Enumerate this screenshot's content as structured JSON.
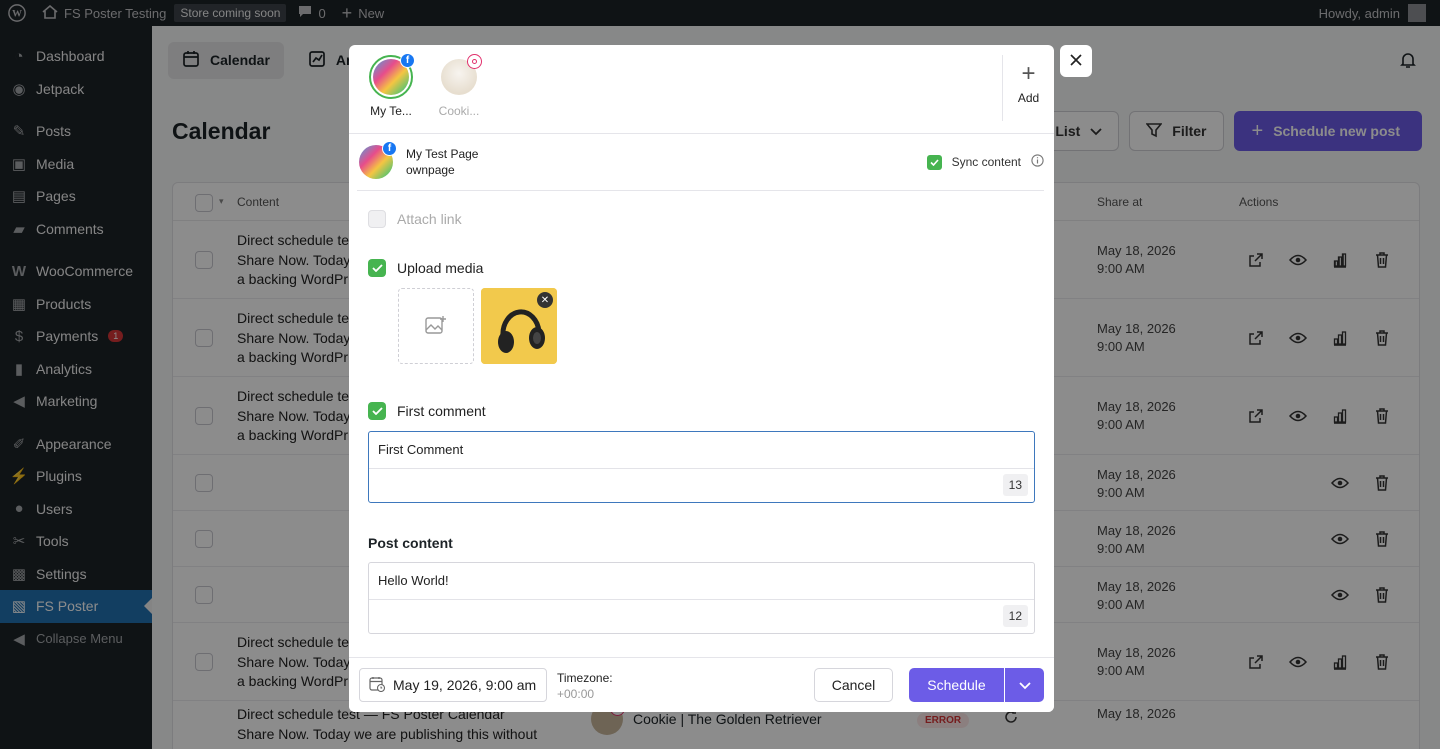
{
  "adminbar": {
    "site_name": "FS Poster Testing",
    "store_badge": "Store coming soon",
    "comments_count": "0",
    "new_label": "New",
    "howdy": "Howdy, admin"
  },
  "sidebar": {
    "items": [
      {
        "label": "Dashboard",
        "icon": "dashboard-icon"
      },
      {
        "label": "Jetpack",
        "icon": "jetpack-icon"
      },
      {
        "label": "Posts",
        "icon": "pin-icon"
      },
      {
        "label": "Media",
        "icon": "media-icon"
      },
      {
        "label": "Pages",
        "icon": "pages-icon"
      },
      {
        "label": "Comments",
        "icon": "comments-icon"
      },
      {
        "label": "WooCommerce",
        "icon": "woocommerce-icon"
      },
      {
        "label": "Products",
        "icon": "products-icon"
      },
      {
        "label": "Payments",
        "icon": "payments-icon",
        "badge": "1"
      },
      {
        "label": "Analytics",
        "icon": "analytics-icon"
      },
      {
        "label": "Marketing",
        "icon": "marketing-icon"
      },
      {
        "label": "Appearance",
        "icon": "appearance-icon"
      },
      {
        "label": "Plugins",
        "icon": "plugins-icon"
      },
      {
        "label": "Users",
        "icon": "users-icon"
      },
      {
        "label": "Tools",
        "icon": "tools-icon"
      },
      {
        "label": "Settings",
        "icon": "settings-icon"
      },
      {
        "label": "FS Poster",
        "icon": "fs-poster-icon"
      },
      {
        "label": "Collapse Menu",
        "icon": "collapse-icon"
      }
    ]
  },
  "topbar": {
    "tab_calendar": "Calendar",
    "tab_analytics": "An"
  },
  "page": {
    "title": "Calendar",
    "list_label": "List",
    "filter_label": "Filter",
    "schedule_new_label": "Schedule new post"
  },
  "table": {
    "col_content": "Content",
    "col_share_at": "Share at",
    "col_actions": "Actions",
    "rows": [
      {
        "line1": "Direct schedule te",
        "line2": "Share Now. Today",
        "line3": "a backing WordPr",
        "date": "May 18, 2026",
        "time": "9:00 AM"
      },
      {
        "line1": "Direct schedule te",
        "line2": "Share Now. Today",
        "line3": "a backing WordPr",
        "date": "May 18, 2026",
        "time": "9:00 AM"
      },
      {
        "line1": "Direct schedule te",
        "line2": "Share Now. Today",
        "line3": "a backing WordPr",
        "date": "May 18, 2026",
        "time": "9:00 AM"
      },
      {
        "line1": "",
        "line2": "",
        "line3": "",
        "date": "May 18, 2026",
        "time": "9:00 AM"
      },
      {
        "line1": "",
        "line2": "",
        "line3": "",
        "date": "May 18, 2026",
        "time": "9:00 AM"
      },
      {
        "line1": "",
        "line2": "",
        "line3": "",
        "date": "May 18, 2026",
        "time": "9:00 AM"
      },
      {
        "line1": "Direct schedule te",
        "line2": "Share Now. Today",
        "line3": "a backing WordPr",
        "date": "May 18, 2026",
        "time": "9:00 AM"
      }
    ],
    "last_row": {
      "content": "Direct schedule test — FS Poster Calendar",
      "content2": "Share Now. Today we are publishing this without",
      "channel": "Cookie | The Golden Retriever",
      "status": "ERROR",
      "date": "May 18, 2026"
    }
  },
  "modal": {
    "accounts": [
      {
        "name": "My Te...",
        "network": "facebook"
      },
      {
        "name": "Cooki...",
        "network": "instagram"
      }
    ],
    "add_label": "Add",
    "channel": {
      "name": "My Test Page",
      "sub": "ownpage"
    },
    "sync_label": "Sync content",
    "attach_link_label": "Attach link",
    "upload_media_label": "Upload media",
    "first_comment_label": "First comment",
    "first_comment_value": "First Comment",
    "first_comment_count": "13",
    "post_content_title": "Post content",
    "post_content_value": "Hello World!",
    "post_content_count": "12",
    "date_value": "May 19, 2026, 9:00 am",
    "timezone_label": "Timezone:",
    "timezone_value": "+00:00",
    "cancel_label": "Cancel",
    "schedule_label": "Schedule"
  },
  "colors": {
    "primary": "#6c5ce7",
    "check_green": "#46b450",
    "admin_dark": "#1d2327",
    "active_menu": "#2271b1",
    "facebook": "#1877f2"
  }
}
